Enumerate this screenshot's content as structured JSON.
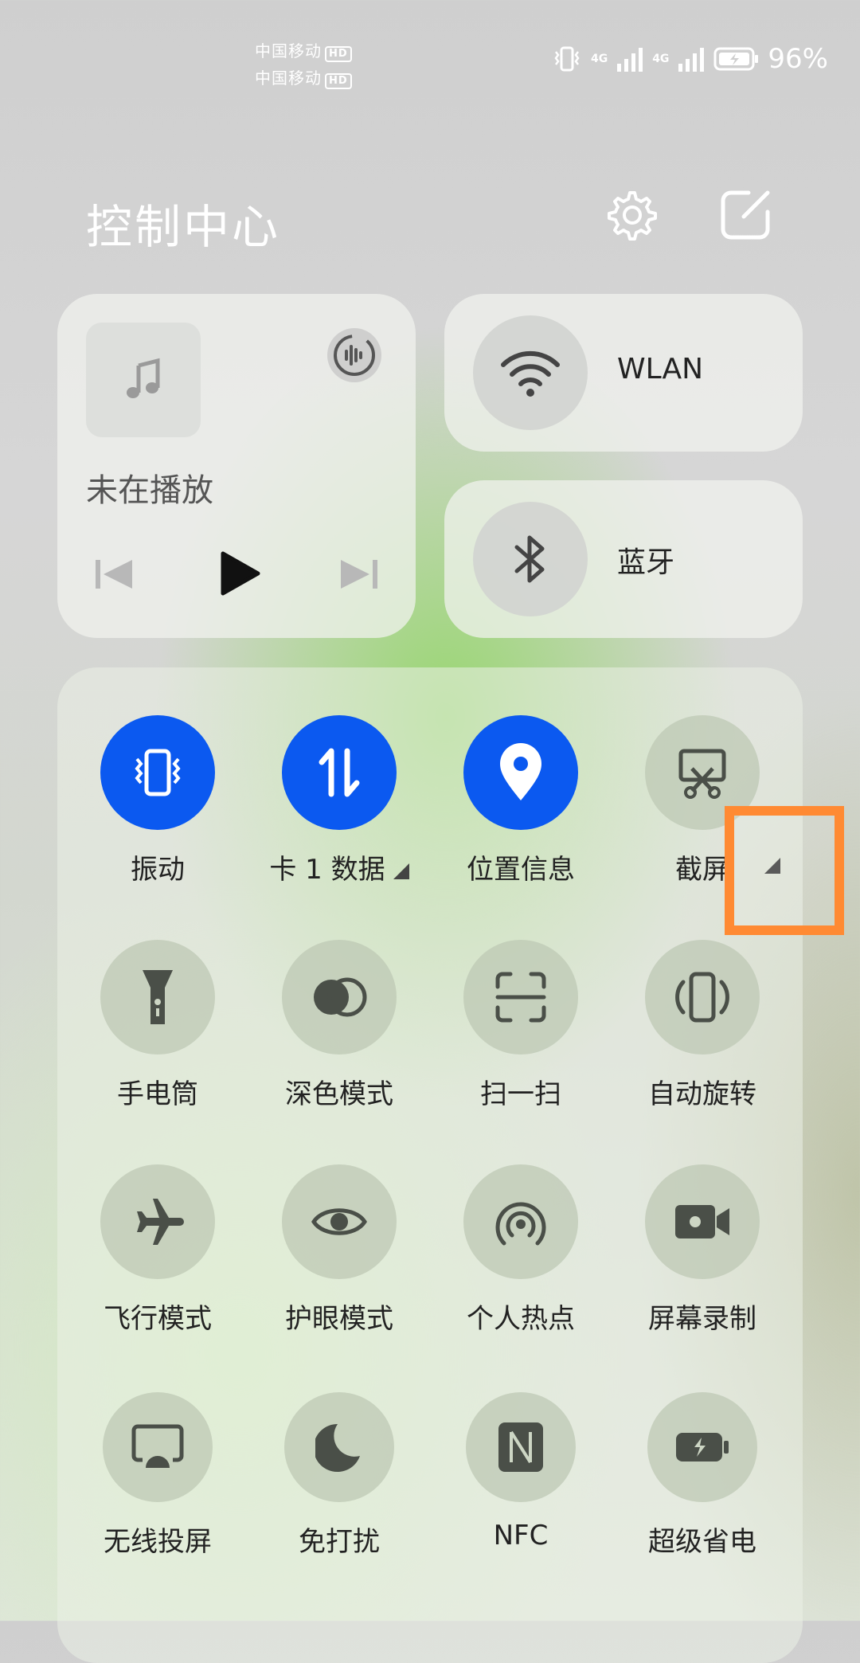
{
  "status_bar": {
    "carrier1": "中国移动",
    "carrier2": "中国移动",
    "hd_badge": "HD",
    "net1": "4G",
    "net2": "4G",
    "battery_percent": "96%"
  },
  "header": {
    "title": "控制中心",
    "settings_icon": "gear-icon",
    "edit_icon": "edit-icon"
  },
  "media": {
    "status": "未在播放",
    "art_icon": "music-note-icon"
  },
  "connectivity": [
    {
      "label": "WLAN",
      "icon": "wifi-icon"
    },
    {
      "label": "蓝牙",
      "icon": "bluetooth-icon"
    }
  ],
  "tiles": [
    {
      "label": "振动",
      "icon": "vibrate-icon",
      "active": true
    },
    {
      "label": "卡 1 数据",
      "icon": "mobile-data-icon",
      "active": true
    },
    {
      "label": "位置信息",
      "icon": "location-icon",
      "active": true
    },
    {
      "label": "截屏",
      "icon": "screenshot-icon",
      "active": false
    },
    {
      "label": "手电筒",
      "icon": "flashlight-icon",
      "active": false
    },
    {
      "label": "深色模式",
      "icon": "dark-mode-icon",
      "active": false
    },
    {
      "label": "扫一扫",
      "icon": "scan-icon",
      "active": false
    },
    {
      "label": "自动旋转",
      "icon": "auto-rotate-icon",
      "active": false
    },
    {
      "label": "飞行模式",
      "icon": "airplane-icon",
      "active": false
    },
    {
      "label": "护眼模式",
      "icon": "eye-icon",
      "active": false
    },
    {
      "label": "个人热点",
      "icon": "hotspot-icon",
      "active": false
    },
    {
      "label": "屏幕录制",
      "icon": "screen-record-icon",
      "active": false
    },
    {
      "label": "无线投屏",
      "icon": "cast-icon",
      "active": false
    },
    {
      "label": "免打扰",
      "icon": "moon-icon",
      "active": false
    },
    {
      "label": "NFC",
      "icon": "nfc-icon",
      "active": false
    },
    {
      "label": "超级省电",
      "icon": "battery-saver-icon",
      "active": false
    }
  ],
  "colors": {
    "active_tile": "#0b59f0",
    "highlight": "#ff8a33"
  }
}
